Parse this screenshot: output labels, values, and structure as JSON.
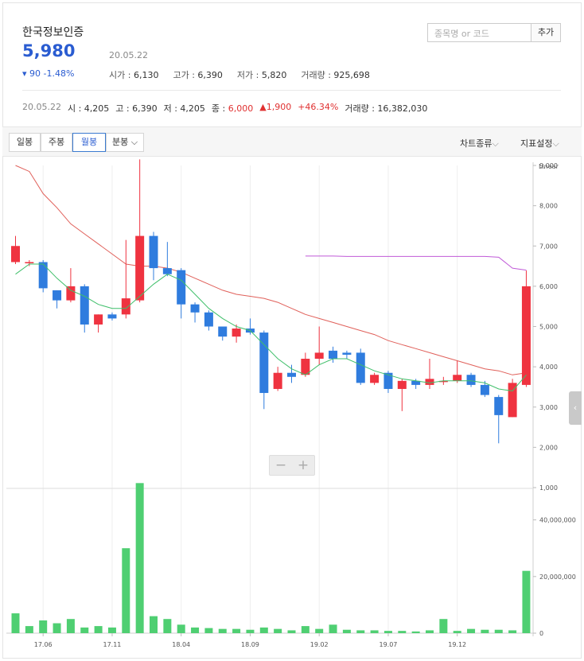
{
  "header": {
    "stock_name": "한국정보인증",
    "price": "5,980",
    "change": "▾ 90 -1.48%",
    "date": "20.05.22",
    "stats": [
      {
        "label": "시가 : ",
        "value": "6,130"
      },
      {
        "label": "고가 : ",
        "value": "6,390"
      },
      {
        "label": "저가 : ",
        "value": "5,820"
      },
      {
        "label": "거래량 : ",
        "value": "925,698"
      }
    ],
    "search_placeholder": "종목명 or 코드",
    "add_label": "추가"
  },
  "summary": {
    "date": "20.05.22",
    "open": "시 : 4,205",
    "high": "고 : 6,390",
    "low": "저 : 4,205",
    "close_label": "종 : ",
    "close": "6,000",
    "diff": "▲1,900",
    "pct": "+46.34%",
    "volume": "거래량 : 16,382,030"
  },
  "toolbar": {
    "tabs": [
      "일봉",
      "주봉",
      "월봉",
      "분봉"
    ],
    "active_tab": "월봉",
    "chart_type": "차트종류",
    "indicator": "지표설정"
  },
  "chart_data": {
    "type": "candlestick",
    "scale_label": "Linear",
    "price_ticks": [
      "9,000",
      "8,000",
      "7,000",
      "6,000",
      "5,000",
      "4,000",
      "3,000",
      "2,000",
      "1,000"
    ],
    "price_tick_values": [
      9000,
      8000,
      7000,
      6000,
      5000,
      4000,
      3000,
      2000,
      1000
    ],
    "volume_ticks": [
      "40,000,000",
      "20,000,000",
      "0"
    ],
    "volume_tick_values": [
      40000000,
      20000000,
      0
    ],
    "x_labels": [
      "17.06",
      "17.11",
      "18.04",
      "18.09",
      "19.02",
      "19.07",
      "19.12"
    ],
    "x_label_index": [
      2,
      7,
      12,
      17,
      22,
      27,
      32
    ],
    "ylim": [
      1000,
      9000
    ],
    "vol_max": 50000000,
    "candles": [
      [
        6600,
        7000,
        7250,
        6550
      ],
      [
        6600,
        6600,
        6650,
        6500
      ],
      [
        6600,
        5950,
        6650,
        5850
      ],
      [
        5900,
        5650,
        5900,
        5450
      ],
      [
        5650,
        6000,
        6450,
        5600
      ],
      [
        6000,
        5050,
        6050,
        4850
      ],
      [
        5050,
        5300,
        5300,
        4850
      ],
      [
        5300,
        5200,
        5350,
        5150
      ],
      [
        5300,
        5700,
        7150,
        5200
      ],
      [
        5650,
        7250,
        9150,
        5600
      ],
      [
        7250,
        6450,
        7350,
        6150
      ],
      [
        6450,
        6300,
        7100,
        6250
      ],
      [
        6400,
        5550,
        6450,
        5200
      ],
      [
        5550,
        5350,
        5600,
        5100
      ],
      [
        5350,
        5000,
        5400,
        4900
      ],
      [
        5000,
        4750,
        5000,
        4650
      ],
      [
        4750,
        4950,
        5050,
        4600
      ],
      [
        4950,
        4850,
        5200,
        4800
      ],
      [
        4850,
        3350,
        4900,
        2950
      ],
      [
        3450,
        3850,
        4000,
        3400
      ],
      [
        3850,
        3750,
        4050,
        3600
      ],
      [
        3800,
        4200,
        4350,
        3750
      ],
      [
        4200,
        4350,
        5000,
        4050
      ],
      [
        4400,
        4200,
        4500,
        4100
      ],
      [
        4350,
        4300,
        4400,
        4200
      ],
      [
        4350,
        3600,
        4450,
        3550
      ],
      [
        3600,
        3800,
        3850,
        3550
      ],
      [
        3850,
        3450,
        3900,
        3350
      ],
      [
        3450,
        3650,
        3700,
        2900
      ],
      [
        3650,
        3550,
        3700,
        3450
      ],
      [
        3550,
        3700,
        4200,
        3450
      ],
      [
        3650,
        3650,
        3750,
        3550
      ],
      [
        3650,
        3800,
        4150,
        3600
      ],
      [
        3800,
        3550,
        3850,
        3500
      ],
      [
        3550,
        3300,
        3650,
        3250
      ],
      [
        3250,
        2800,
        3300,
        2100
      ],
      [
        2750,
        3600,
        3700,
        2750
      ],
      [
        3550,
        6000,
        6390,
        3500
      ]
    ],
    "volume": [
      7000000,
      2500000,
      4500000,
      3500000,
      5000000,
      2000000,
      2500000,
      2000000,
      30000000,
      53000000,
      6000000,
      5000000,
      3000000,
      2000000,
      1800000,
      1500000,
      1500000,
      1200000,
      2000000,
      1500000,
      1000000,
      2500000,
      1500000,
      3000000,
      1200000,
      1000000,
      1000000,
      800000,
      800000,
      600000,
      1000000,
      5000000,
      800000,
      1500000,
      1200000,
      1200000,
      1000000,
      22000000
    ],
    "ma_short": [
      6300,
      6550,
      6550,
      6200,
      5900,
      5750,
      5550,
      5450,
      5450,
      5750,
      6050,
      6300,
      6150,
      5800,
      5450,
      5200,
      5000,
      4900,
      4550,
      4200,
      3950,
      3800,
      4050,
      4200,
      4200,
      4050,
      3900,
      3800,
      3700,
      3650,
      3600,
      3650,
      3650,
      3650,
      3600,
      3450,
      3400,
      3800
    ],
    "ma_long": [
      9000,
      8850,
      8300,
      7950,
      7550,
      7300,
      7050,
      6800,
      6550,
      6500,
      6500,
      6450,
      6350,
      6200,
      6050,
      5900,
      5800,
      5750,
      5700,
      5600,
      5450,
      5300,
      5200,
      5100,
      5000,
      4900,
      4800,
      4650,
      4550,
      4450,
      4350,
      4250,
      4150,
      4050,
      3950,
      3900,
      3800,
      3850
    ],
    "ma_top_start": 21,
    "ma_top": [
      6750,
      6750,
      6750,
      6740,
      6740,
      6740,
      6740,
      6740,
      6740,
      6740,
      6740,
      6740,
      6740,
      6740,
      6720,
      6450,
      6400
    ]
  }
}
